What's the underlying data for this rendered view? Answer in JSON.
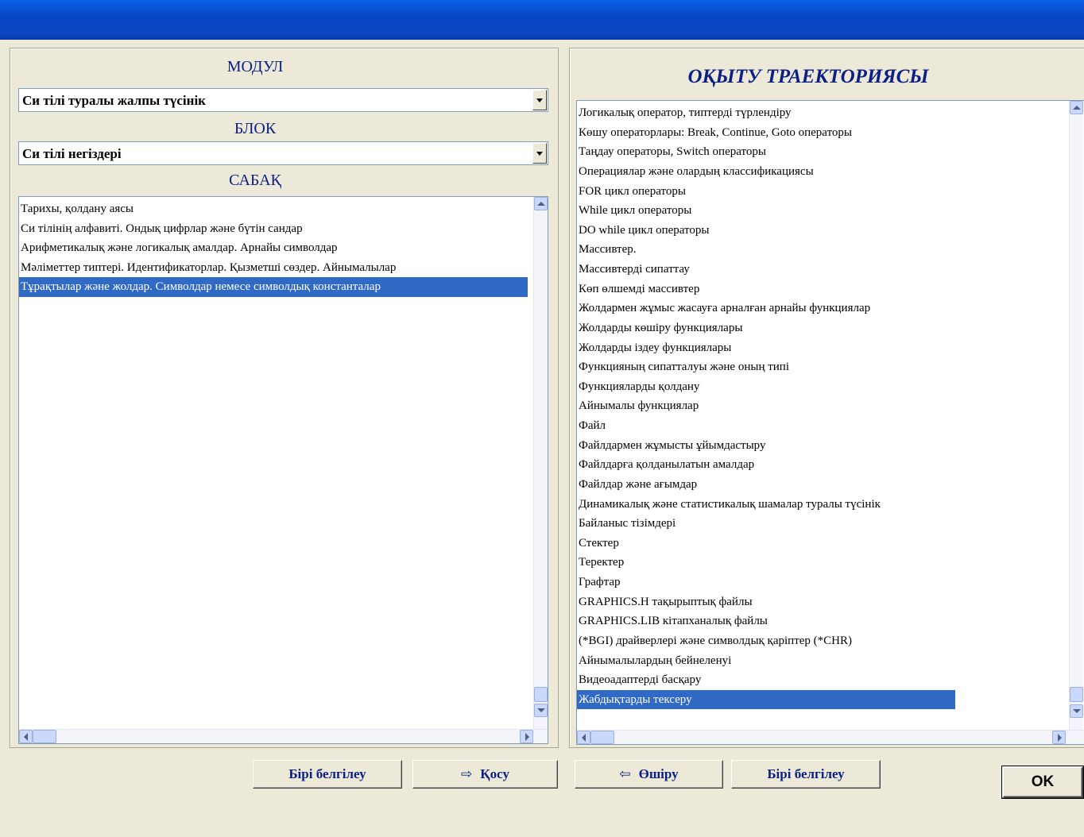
{
  "window": {
    "title": ""
  },
  "left": {
    "module_label": "МОДУЛ",
    "module_value": "Си тілі туралы жалпы түсінік",
    "block_label": "БЛОК",
    "block_value": "Си тілі негіздері",
    "lesson_label": "САБАҚ",
    "lessons": [
      "Тарихы, қолдану аясы",
      "Си тілінің алфавиті. Ондық цифрлар және бүтін сандар",
      "Арифметикалық және логикалық амалдар. Арнайы символдар",
      "Мәліметтер типтері. Идентификаторлар. Қызметші сөздер. Айнымалылар",
      "Тұрақтылар және жолдар. Символдар немесе символдық константалар"
    ],
    "selected_index": 4
  },
  "right": {
    "title": "ОҚЫТУ ТРАЕКТОРИЯСЫ",
    "items": [
      "Логикалық оператор, типтерді түрлендіру",
      "Көшу операторлары: Break, Continue, Goto операторы",
      "Таңдау операторы, Switch операторы",
      "Операциялар және олардың классификациясы",
      "FOR цикл операторы",
      "While цикл операторы",
      "DO while цикл операторы",
      "Массивтер.",
      "Массивтерді сипаттау",
      "Көп өлшемді массивтер",
      "Жолдармен жұмыс жасауға арналған арнайы функциялар",
      "Жолдарды көшіру функциялары",
      "Жолдарды іздеу функциялары",
      "Функцияның сипатталуы және оның типі",
      "Функцияларды қолдану",
      "Айнымалы функциялар",
      "Файл",
      "Файлдармен жұмысты ұйымдастыру",
      " Файлдарға қолданылатын амалдар",
      "Файлдар және ағымдар",
      "Динамикалық және статистикалық шамалар туралы түсінік",
      "Байланыс тізімдері",
      "Стектер",
      "Теректер",
      "Графтар",
      "GRAPHICS.H тақырыптық файлы",
      "GRAPHICS.LIB кітапханалық файлы",
      "(*BGI) драйверлері және символдық қаріптер (*CHR)",
      "Айнымалылардың бейнеленуі",
      "Видеоадаптерді басқару",
      "Жабдықтарды тексеру"
    ],
    "selected_index": 30
  },
  "buttons": {
    "select_all_left": "Бірі белгілеу",
    "add": "Қосу",
    "remove": "Өшіру",
    "select_all_right": "Бірі белгілеу",
    "ok": "OK"
  },
  "icons": {
    "add": "arrow-right-icon",
    "remove": "arrow-left-icon"
  },
  "colors": {
    "titlebar": "#0a5fe8",
    "header_text": "#0c1f86",
    "selection": "#316ac5",
    "face": "#ece9d8"
  }
}
